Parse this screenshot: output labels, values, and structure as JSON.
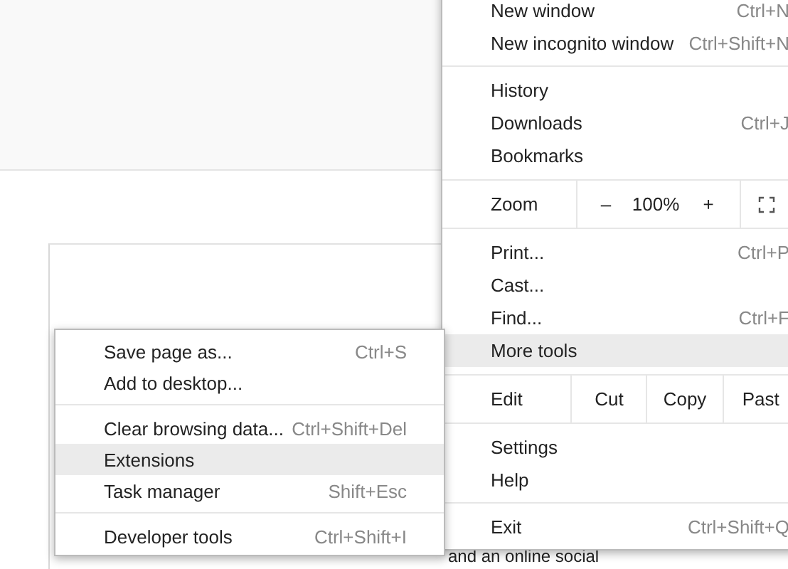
{
  "page": {
    "text": "and an online social"
  },
  "main_menu": {
    "items": [
      {
        "kind": "item",
        "label": "New window",
        "shortcut": "Ctrl+N",
        "selected": false
      },
      {
        "kind": "item",
        "label": "New incognito window",
        "shortcut": "Ctrl+Shift+N",
        "selected": false
      },
      {
        "kind": "separator"
      },
      {
        "kind": "item",
        "label": "History",
        "selected": false
      },
      {
        "kind": "item",
        "label": "Downloads",
        "shortcut": "Ctrl+J",
        "selected": false
      },
      {
        "kind": "item",
        "label": "Bookmarks",
        "selected": false
      },
      {
        "kind": "zoom",
        "label": "Zoom",
        "minus": "–",
        "value": "100%",
        "plus": "+"
      },
      {
        "kind": "item",
        "label": "Print...",
        "shortcut": "Ctrl+P",
        "selected": false
      },
      {
        "kind": "item",
        "label": "Cast...",
        "selected": false
      },
      {
        "kind": "item",
        "label": "Find...",
        "shortcut": "Ctrl+F",
        "selected": false
      },
      {
        "kind": "item",
        "label": "More tools",
        "selected": true
      },
      {
        "kind": "edit",
        "label": "Edit",
        "buttons": [
          "Cut",
          "Copy",
          "Past"
        ]
      },
      {
        "kind": "item",
        "label": "Settings",
        "selected": false
      },
      {
        "kind": "item",
        "label": "Help",
        "selected": false
      },
      {
        "kind": "separator"
      },
      {
        "kind": "item",
        "label": "Exit",
        "shortcut": "Ctrl+Shift+Q",
        "selected": false
      }
    ]
  },
  "submenu": {
    "items": [
      {
        "kind": "item",
        "label": "Save page as...",
        "shortcut": "Ctrl+S",
        "selected": false
      },
      {
        "kind": "item",
        "label": "Add to desktop...",
        "selected": false
      },
      {
        "kind": "separator"
      },
      {
        "kind": "item",
        "label": "Clear browsing data...",
        "shortcut": "Ctrl+Shift+Del",
        "selected": false
      },
      {
        "kind": "item",
        "label": "Extensions",
        "selected": true
      },
      {
        "kind": "item",
        "label": "Task manager",
        "shortcut": "Shift+Esc",
        "selected": false
      },
      {
        "kind": "separator"
      },
      {
        "kind": "item",
        "label": "Developer tools",
        "shortcut": "Ctrl+Shift+I",
        "selected": false
      }
    ]
  }
}
